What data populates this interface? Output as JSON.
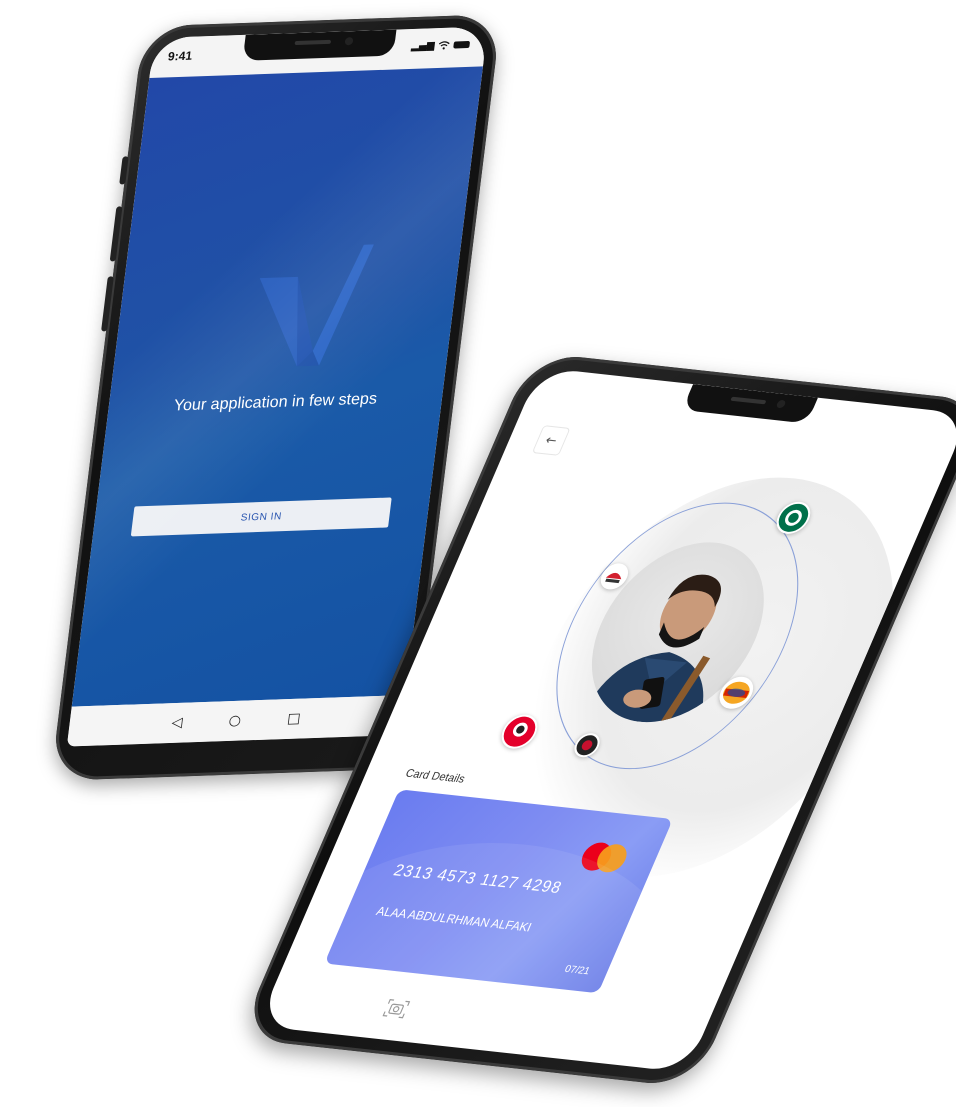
{
  "phone_signin": {
    "status_time": "9:41",
    "tagline": "Your application in few steps",
    "signin_label": "SIGN IN",
    "nav": {
      "back_icon": "◁",
      "home_icon": "○",
      "recents_icon": "□"
    },
    "colors": {
      "primary": "#1f52a6",
      "button_text": "#2a56b0"
    }
  },
  "phone_card": {
    "back_icon": "←",
    "section_title": "Card Details",
    "card": {
      "number": "2313 4573 1127 4298",
      "holder": "ALAA ABDULRHMAN ALFAKI",
      "expiry": "07/21",
      "brand": "mastercard-logo",
      "gradient_start": "#6a7cf0",
      "gradient_end": "#8a9cf5"
    },
    "brands": [
      "starbucks-logo",
      "pizza-hut-logo",
      "burger-king-logo",
      "kfc-logo",
      "restaurant-logo"
    ],
    "camera_icon": "camera-scan-icon"
  }
}
